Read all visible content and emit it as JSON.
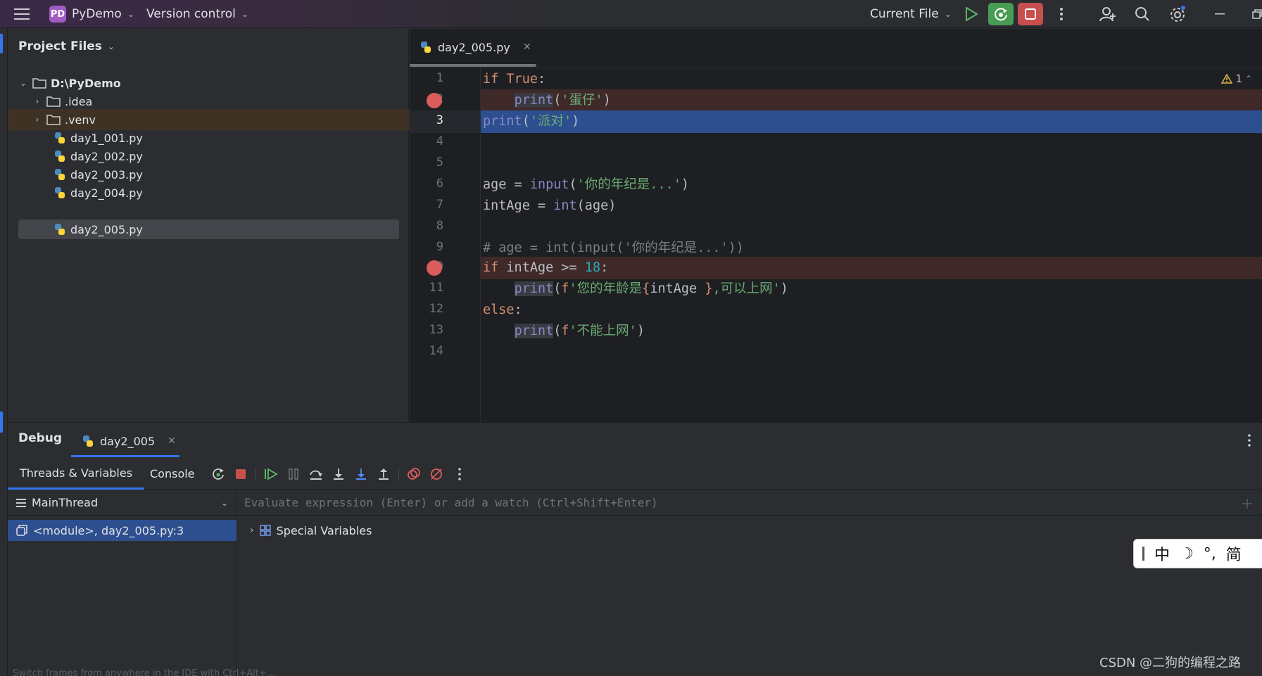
{
  "titlebar": {
    "project_badge": "PD",
    "project_name": "PyDemo",
    "vcs": "Version control",
    "run_config": "Current File"
  },
  "project_panel": {
    "title": "Project Files",
    "items": [
      {
        "label": "D:\\PyDemo",
        "type": "folder",
        "expanded": true
      },
      {
        "label": ".idea",
        "type": "folder",
        "expanded": false
      },
      {
        "label": ".venv",
        "type": "folder",
        "expanded": false
      },
      {
        "label": "day1_001.py",
        "type": "python"
      },
      {
        "label": "day2_002.py",
        "type": "python"
      },
      {
        "label": "day2_003.py",
        "type": "python"
      },
      {
        "label": "day2_004.py",
        "type": "python"
      },
      {
        "label": "day2_005.py",
        "type": "python",
        "selected": true
      }
    ]
  },
  "editor": {
    "tab_label": "day2_005.py",
    "warning_count": "1",
    "line_numbers": [
      "1",
      "2",
      "3",
      "4",
      "5",
      "6",
      "7",
      "8",
      "9",
      "10",
      "11",
      "12",
      "13",
      "14"
    ],
    "current_line": 3,
    "breakpoints": [
      2,
      10
    ]
  },
  "debug": {
    "title": "Debug",
    "session_tab": "day2_005",
    "tabs": [
      "Threads & Variables",
      "Console"
    ],
    "thread": "MainThread",
    "frame": "<module>, day2_005.py:3",
    "eval_placeholder": "Evaluate expression (Enter) or add a watch (Ctrl+Shift+Enter)",
    "special_variables": "Special Variables",
    "status_hint": "Switch frames from anywhere in the IDE with Ctrl+Alt+..."
  },
  "ime": {
    "chars": [
      "中",
      "☽",
      "°,",
      "简"
    ]
  },
  "watermark": "CSDN @二狗的编程之路",
  "colors": {
    "accent": "#3574f0",
    "breakpoint": "#db5c5c",
    "run_green": "#499c54",
    "stop_red": "#c94f4f"
  }
}
